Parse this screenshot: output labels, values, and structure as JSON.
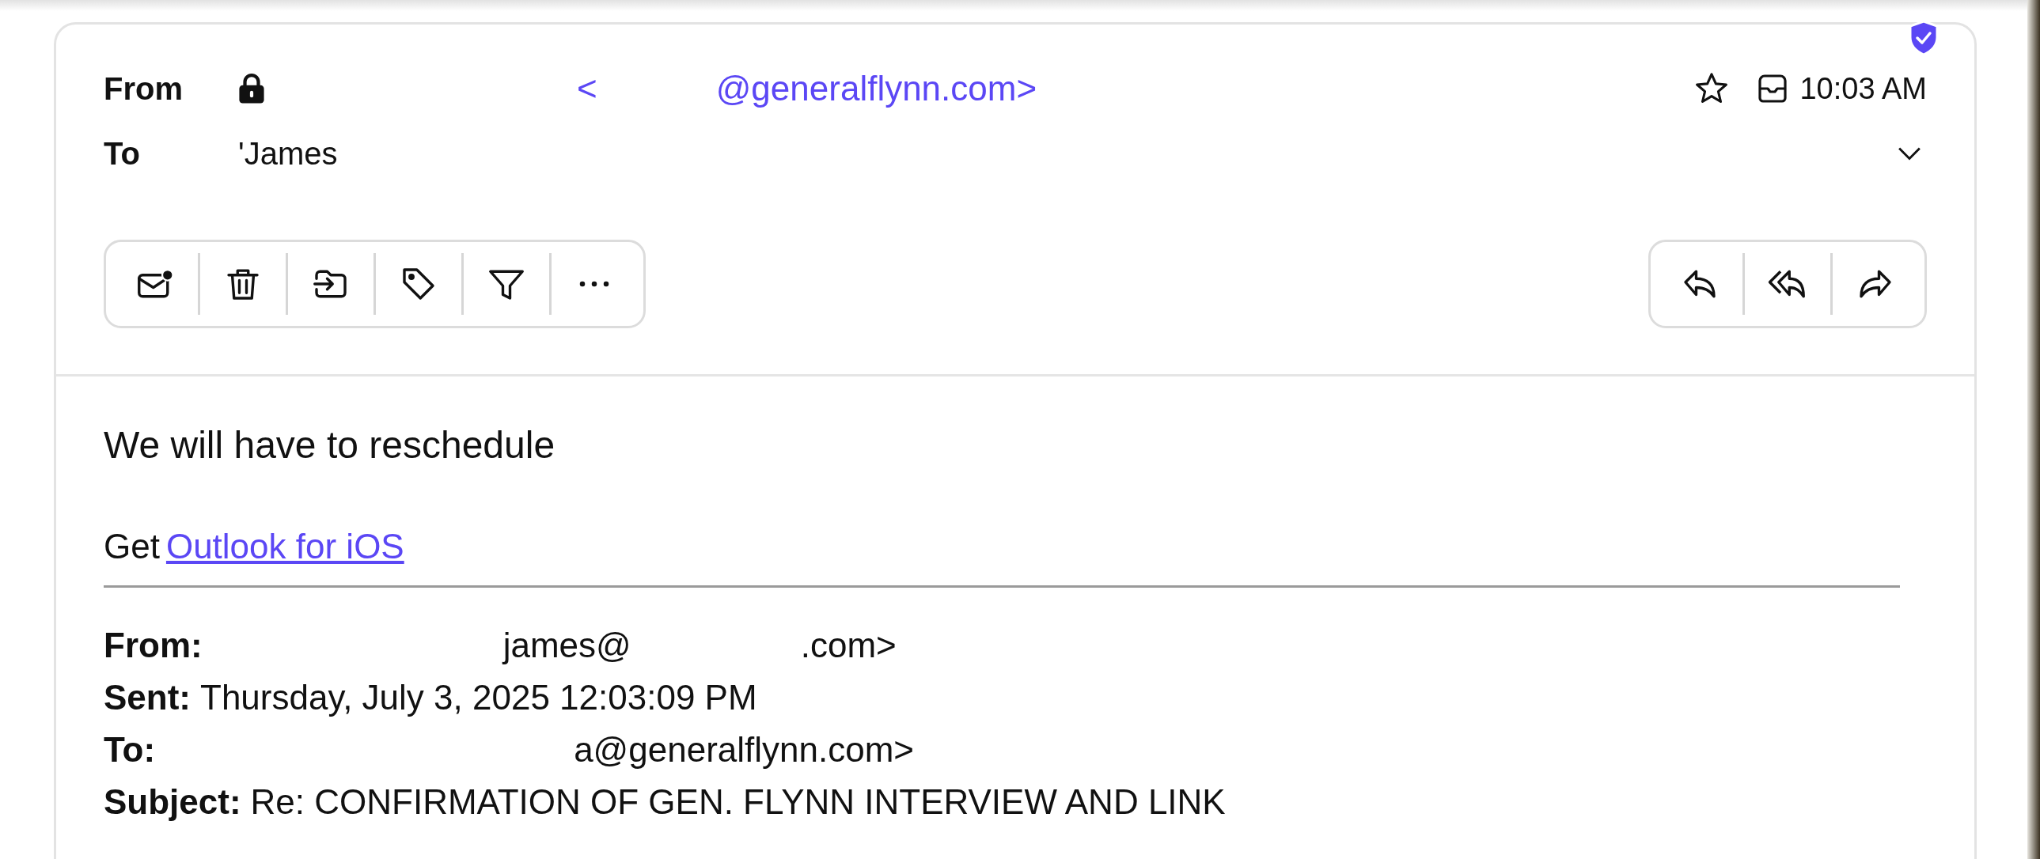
{
  "header": {
    "from_label": "From",
    "from_parts": [
      "<",
      "@generalflynn.com>"
    ],
    "to_label": "To",
    "to_value": "'James",
    "time": "10:03 AM",
    "starred": false
  },
  "toolbar": [
    {
      "kind": "unread"
    },
    {
      "kind": "delete"
    },
    {
      "kind": "move"
    },
    {
      "kind": "tag"
    },
    {
      "kind": "filter"
    },
    {
      "kind": "more"
    }
  ],
  "reply_actions": [
    {
      "kind": "reply"
    },
    {
      "kind": "reply_all"
    },
    {
      "kind": "forward"
    }
  ],
  "body": {
    "message": "We will have to reschedule",
    "signature_prefix": "Get",
    "signature_link": "Outlook for iOS"
  },
  "quoted_header": [
    {
      "label": "From:",
      "parts": [
        "james@",
        ".com>"
      ]
    },
    {
      "label": "Sent:",
      "parts": [
        "Thursday, July 3, 2025 12:03:09 PM"
      ]
    },
    {
      "label": "To:",
      "parts": [
        "a@generalflynn.com>"
      ]
    },
    {
      "label": "Subject:",
      "parts": [
        "Re: CONFIRMATION OF GEN. FLYNN INTERVIEW AND LINK"
      ]
    }
  ]
}
